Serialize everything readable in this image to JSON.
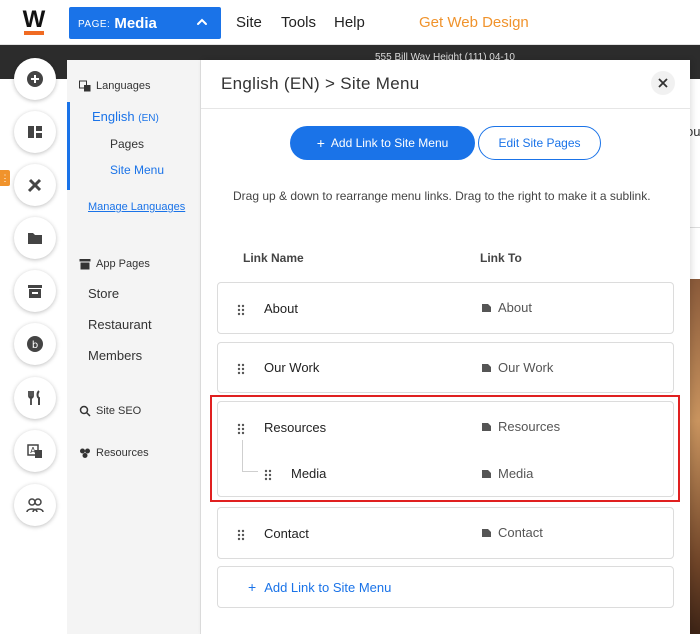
{
  "topbar": {
    "page_prefix": "PAGE:",
    "page_name": "Media",
    "menu": [
      "Site",
      "Tools",
      "Help"
    ],
    "cta": "Get Web Design",
    "accent": "#1a73e8",
    "cta_color": "#f0932c"
  },
  "background": {
    "strip_text": "555 Bill Way Height (111) 04-10",
    "preview_text": "ou",
    "side_text": "b"
  },
  "rail": {
    "icons": [
      "add-icon",
      "layout-icon",
      "design-tools-icon",
      "folder-icon",
      "store-icon",
      "blog-icon",
      "restaurant-icon",
      "translate-icon",
      "members-icon"
    ]
  },
  "subpanel": {
    "languages_heading": "Languages",
    "english_label": "English",
    "english_code": "(EN)",
    "pages_label": "Pages",
    "site_menu_label": "Site Menu",
    "manage_label": "Manage Languages",
    "app_pages_heading": "App Pages",
    "app_pages": [
      "Store",
      "Restaurant",
      "Members"
    ],
    "seo_label": "Site SEO",
    "resources_label": "Resources"
  },
  "panel": {
    "title": "English (EN) > Site Menu",
    "add_button": "Add Link to Site Menu",
    "edit_button": "Edit Site Pages",
    "help_text": "Drag up & down to rearrange menu links. Drag to the right to make it a sublink.",
    "col_name": "Link Name",
    "col_link": "Link To",
    "rows": [
      {
        "name": "About",
        "link": "About"
      },
      {
        "name": "Our Work",
        "link": "Our Work"
      },
      {
        "name": "Resources",
        "link": "Resources",
        "sub": {
          "name": "Media",
          "link": "Media"
        }
      },
      {
        "name": "Contact",
        "link": "Contact"
      }
    ],
    "add_row_label": "Add Link to Site Menu"
  }
}
